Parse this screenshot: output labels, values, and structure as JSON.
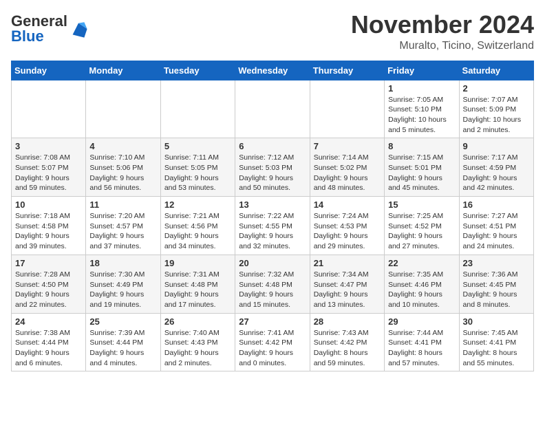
{
  "header": {
    "logo_general": "General",
    "logo_blue": "Blue",
    "month_title": "November 2024",
    "location": "Muralto, Ticino, Switzerland"
  },
  "weekdays": [
    "Sunday",
    "Monday",
    "Tuesday",
    "Wednesday",
    "Thursday",
    "Friday",
    "Saturday"
  ],
  "weeks": [
    [
      {
        "day": "",
        "info": ""
      },
      {
        "day": "",
        "info": ""
      },
      {
        "day": "",
        "info": ""
      },
      {
        "day": "",
        "info": ""
      },
      {
        "day": "",
        "info": ""
      },
      {
        "day": "1",
        "info": "Sunrise: 7:05 AM\nSunset: 5:10 PM\nDaylight: 10 hours and 5 minutes."
      },
      {
        "day": "2",
        "info": "Sunrise: 7:07 AM\nSunset: 5:09 PM\nDaylight: 10 hours and 2 minutes."
      }
    ],
    [
      {
        "day": "3",
        "info": "Sunrise: 7:08 AM\nSunset: 5:07 PM\nDaylight: 9 hours and 59 minutes."
      },
      {
        "day": "4",
        "info": "Sunrise: 7:10 AM\nSunset: 5:06 PM\nDaylight: 9 hours and 56 minutes."
      },
      {
        "day": "5",
        "info": "Sunrise: 7:11 AM\nSunset: 5:05 PM\nDaylight: 9 hours and 53 minutes."
      },
      {
        "day": "6",
        "info": "Sunrise: 7:12 AM\nSunset: 5:03 PM\nDaylight: 9 hours and 50 minutes."
      },
      {
        "day": "7",
        "info": "Sunrise: 7:14 AM\nSunset: 5:02 PM\nDaylight: 9 hours and 48 minutes."
      },
      {
        "day": "8",
        "info": "Sunrise: 7:15 AM\nSunset: 5:01 PM\nDaylight: 9 hours and 45 minutes."
      },
      {
        "day": "9",
        "info": "Sunrise: 7:17 AM\nSunset: 4:59 PM\nDaylight: 9 hours and 42 minutes."
      }
    ],
    [
      {
        "day": "10",
        "info": "Sunrise: 7:18 AM\nSunset: 4:58 PM\nDaylight: 9 hours and 39 minutes."
      },
      {
        "day": "11",
        "info": "Sunrise: 7:20 AM\nSunset: 4:57 PM\nDaylight: 9 hours and 37 minutes."
      },
      {
        "day": "12",
        "info": "Sunrise: 7:21 AM\nSunset: 4:56 PM\nDaylight: 9 hours and 34 minutes."
      },
      {
        "day": "13",
        "info": "Sunrise: 7:22 AM\nSunset: 4:55 PM\nDaylight: 9 hours and 32 minutes."
      },
      {
        "day": "14",
        "info": "Sunrise: 7:24 AM\nSunset: 4:53 PM\nDaylight: 9 hours and 29 minutes."
      },
      {
        "day": "15",
        "info": "Sunrise: 7:25 AM\nSunset: 4:52 PM\nDaylight: 9 hours and 27 minutes."
      },
      {
        "day": "16",
        "info": "Sunrise: 7:27 AM\nSunset: 4:51 PM\nDaylight: 9 hours and 24 minutes."
      }
    ],
    [
      {
        "day": "17",
        "info": "Sunrise: 7:28 AM\nSunset: 4:50 PM\nDaylight: 9 hours and 22 minutes."
      },
      {
        "day": "18",
        "info": "Sunrise: 7:30 AM\nSunset: 4:49 PM\nDaylight: 9 hours and 19 minutes."
      },
      {
        "day": "19",
        "info": "Sunrise: 7:31 AM\nSunset: 4:48 PM\nDaylight: 9 hours and 17 minutes."
      },
      {
        "day": "20",
        "info": "Sunrise: 7:32 AM\nSunset: 4:48 PM\nDaylight: 9 hours and 15 minutes."
      },
      {
        "day": "21",
        "info": "Sunrise: 7:34 AM\nSunset: 4:47 PM\nDaylight: 9 hours and 13 minutes."
      },
      {
        "day": "22",
        "info": "Sunrise: 7:35 AM\nSunset: 4:46 PM\nDaylight: 9 hours and 10 minutes."
      },
      {
        "day": "23",
        "info": "Sunrise: 7:36 AM\nSunset: 4:45 PM\nDaylight: 9 hours and 8 minutes."
      }
    ],
    [
      {
        "day": "24",
        "info": "Sunrise: 7:38 AM\nSunset: 4:44 PM\nDaylight: 9 hours and 6 minutes."
      },
      {
        "day": "25",
        "info": "Sunrise: 7:39 AM\nSunset: 4:44 PM\nDaylight: 9 hours and 4 minutes."
      },
      {
        "day": "26",
        "info": "Sunrise: 7:40 AM\nSunset: 4:43 PM\nDaylight: 9 hours and 2 minutes."
      },
      {
        "day": "27",
        "info": "Sunrise: 7:41 AM\nSunset: 4:42 PM\nDaylight: 9 hours and 0 minutes."
      },
      {
        "day": "28",
        "info": "Sunrise: 7:43 AM\nSunset: 4:42 PM\nDaylight: 8 hours and 59 minutes."
      },
      {
        "day": "29",
        "info": "Sunrise: 7:44 AM\nSunset: 4:41 PM\nDaylight: 8 hours and 57 minutes."
      },
      {
        "day": "30",
        "info": "Sunrise: 7:45 AM\nSunset: 4:41 PM\nDaylight: 8 hours and 55 minutes."
      }
    ]
  ]
}
